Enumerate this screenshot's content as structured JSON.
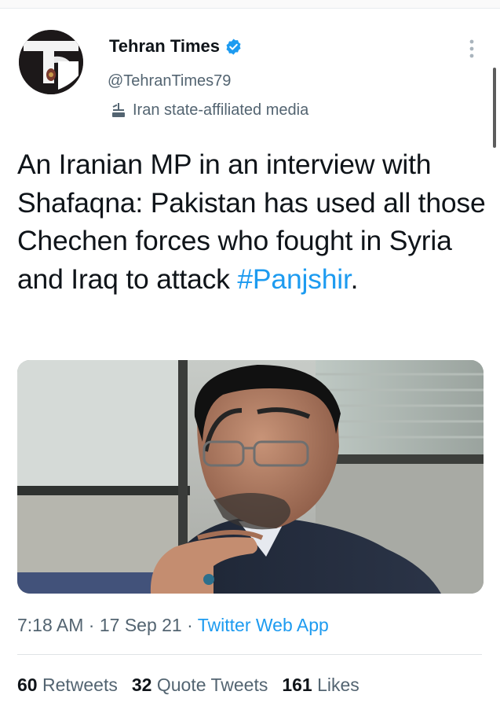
{
  "account": {
    "name": "Tehran Times",
    "handle": "@TehranTimes79",
    "label": "Iran state-affiliated media",
    "verified": true,
    "avatar_letter": "T"
  },
  "tweet": {
    "text": "An Iranian MP in an interview with Shafaqna: Pakistan has used all those Chechen forces who fought in Syria and Iraq to attack",
    "hashtag": "#Panjshir",
    "trailing": "."
  },
  "meta": {
    "time": "7:18 AM",
    "separator": " · ",
    "date": "17 Sep 21",
    "source": "Twitter Web App"
  },
  "stats": {
    "retweets_count": "60",
    "retweets_label": "Retweets",
    "quotes_count": "32",
    "quotes_label": "Quote Tweets",
    "likes_count": "161",
    "likes_label": "Likes"
  },
  "colors": {
    "link": "#1d9bf0",
    "secondary_text": "#536471",
    "primary_text": "#0f1419"
  },
  "icons": [
    "verified-badge-icon",
    "state-media-icon",
    "more-options-icon"
  ]
}
